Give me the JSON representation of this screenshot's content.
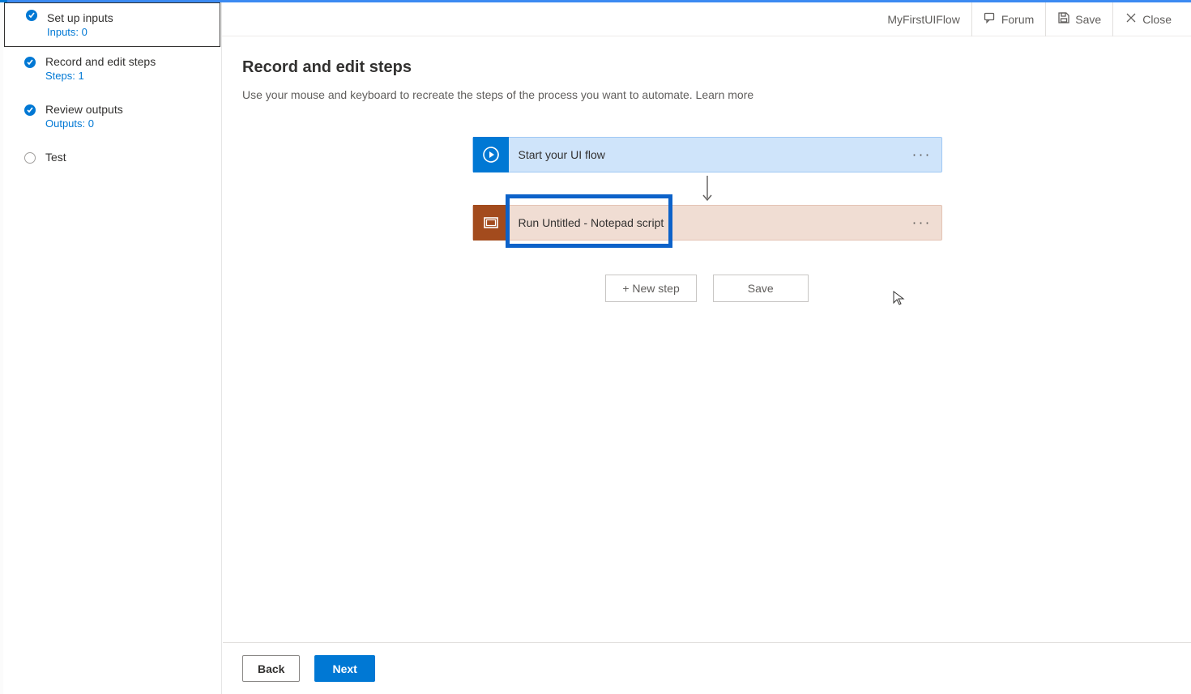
{
  "header": {
    "flow_name": "MyFirstUIFlow",
    "forum": "Forum",
    "save": "Save",
    "close": "Close"
  },
  "sidebar": {
    "steps": [
      {
        "title": "Set up inputs",
        "sub": "Inputs: 0"
      },
      {
        "title": "Record and edit steps",
        "sub": "Steps: 1"
      },
      {
        "title": "Review outputs",
        "sub": "Outputs: 0"
      },
      {
        "title": "Test",
        "sub": ""
      }
    ]
  },
  "main": {
    "heading": "Record and edit steps",
    "description": "Use your mouse and keyboard to recreate the steps of the process you want to automate.  ",
    "learn_more": "Learn more"
  },
  "cards": {
    "start": "Start your UI flow",
    "run": "Run Untitled - Notepad script"
  },
  "actions": {
    "new_step": "+ New step",
    "save": "Save"
  },
  "footer": {
    "back": "Back",
    "next": "Next"
  }
}
